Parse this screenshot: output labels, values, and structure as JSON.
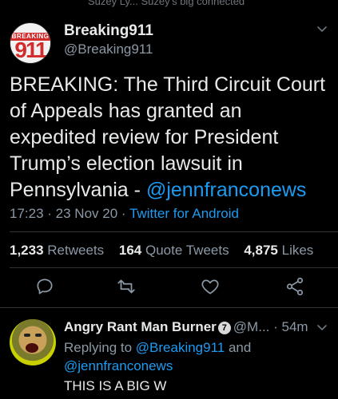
{
  "top_cut_text": "Suzey Ly... Suzey's big connected",
  "tweet": {
    "avatar": {
      "band_text": "BREAKING",
      "big_text": "911"
    },
    "display_name": "Breaking911",
    "handle": "@Breaking911",
    "text_before": "BREAKING: The Third Circuit Court of Appeals has granted an expedited review for President Trump’s election lawsuit in Pennsylvania - ",
    "mention": "@jennfranconews",
    "time": "17:23",
    "sep1": " · ",
    "date": "23 Nov 20",
    "sep2": " · ",
    "source": "Twitter for Android",
    "stats": {
      "retweets_count": "1,233",
      "retweets_label": "Retweets",
      "quotes_count": "164",
      "quotes_label": "Quote Tweets",
      "likes_count": "4,875",
      "likes_label": "Likes"
    },
    "icons": [
      "reply-icon",
      "retweet-icon",
      "like-icon",
      "share-icon"
    ]
  },
  "reply": {
    "display_name": "Angry Rant Man Burner",
    "badge": "7",
    "handle": "@M...",
    "sep": " · ",
    "time": "54m",
    "replying_prefix": "Replying to ",
    "replying_to_1": "@Breaking911",
    "replying_and": " and ",
    "replying_to_2": "@jennfranconews",
    "text": "THIS IS A BIG W"
  },
  "colors": {
    "background": "#000000",
    "accent": "#1d9bf0",
    "muted": "#8b98a5",
    "text": "#e7e9ea"
  }
}
